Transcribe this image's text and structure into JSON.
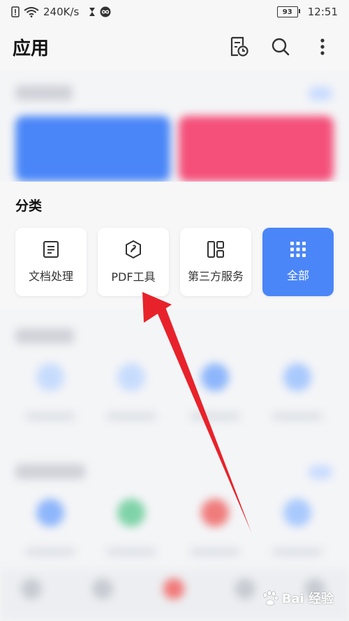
{
  "status_bar": {
    "network_speed": "240K/s",
    "battery": "93",
    "time": "12:51"
  },
  "header": {
    "title": "应用"
  },
  "category": {
    "title": "分类",
    "items": [
      {
        "label": "文档处理",
        "icon": "document-icon"
      },
      {
        "label": "PDF工具",
        "icon": "pdf-tool-icon"
      },
      {
        "label": "第三方服务",
        "icon": "third-party-icon"
      },
      {
        "label": "全部",
        "icon": "grid-icon",
        "active": true
      }
    ]
  },
  "colors": {
    "accent": "#4a86f7",
    "arrow": "#e8222a"
  },
  "watermark": {
    "text": "Bai 经验"
  }
}
